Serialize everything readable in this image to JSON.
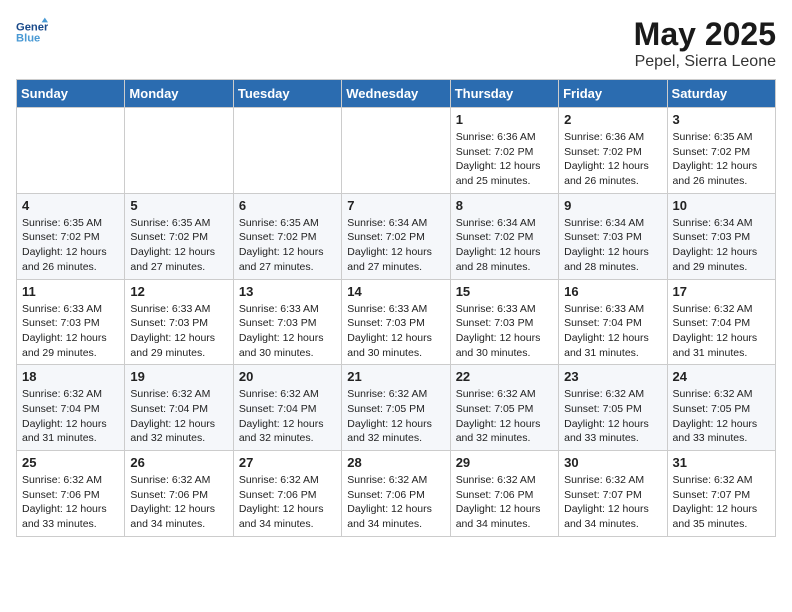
{
  "header": {
    "logo_line1": "General",
    "logo_line2": "Blue",
    "month": "May 2025",
    "location": "Pepel, Sierra Leone"
  },
  "weekdays": [
    "Sunday",
    "Monday",
    "Tuesday",
    "Wednesday",
    "Thursday",
    "Friday",
    "Saturday"
  ],
  "weeks": [
    [
      {
        "day": "",
        "info": ""
      },
      {
        "day": "",
        "info": ""
      },
      {
        "day": "",
        "info": ""
      },
      {
        "day": "",
        "info": ""
      },
      {
        "day": "1",
        "info": "Sunrise: 6:36 AM\nSunset: 7:02 PM\nDaylight: 12 hours\nand 25 minutes."
      },
      {
        "day": "2",
        "info": "Sunrise: 6:36 AM\nSunset: 7:02 PM\nDaylight: 12 hours\nand 26 minutes."
      },
      {
        "day": "3",
        "info": "Sunrise: 6:35 AM\nSunset: 7:02 PM\nDaylight: 12 hours\nand 26 minutes."
      }
    ],
    [
      {
        "day": "4",
        "info": "Sunrise: 6:35 AM\nSunset: 7:02 PM\nDaylight: 12 hours\nand 26 minutes."
      },
      {
        "day": "5",
        "info": "Sunrise: 6:35 AM\nSunset: 7:02 PM\nDaylight: 12 hours\nand 27 minutes."
      },
      {
        "day": "6",
        "info": "Sunrise: 6:35 AM\nSunset: 7:02 PM\nDaylight: 12 hours\nand 27 minutes."
      },
      {
        "day": "7",
        "info": "Sunrise: 6:34 AM\nSunset: 7:02 PM\nDaylight: 12 hours\nand 27 minutes."
      },
      {
        "day": "8",
        "info": "Sunrise: 6:34 AM\nSunset: 7:02 PM\nDaylight: 12 hours\nand 28 minutes."
      },
      {
        "day": "9",
        "info": "Sunrise: 6:34 AM\nSunset: 7:03 PM\nDaylight: 12 hours\nand 28 minutes."
      },
      {
        "day": "10",
        "info": "Sunrise: 6:34 AM\nSunset: 7:03 PM\nDaylight: 12 hours\nand 29 minutes."
      }
    ],
    [
      {
        "day": "11",
        "info": "Sunrise: 6:33 AM\nSunset: 7:03 PM\nDaylight: 12 hours\nand 29 minutes."
      },
      {
        "day": "12",
        "info": "Sunrise: 6:33 AM\nSunset: 7:03 PM\nDaylight: 12 hours\nand 29 minutes."
      },
      {
        "day": "13",
        "info": "Sunrise: 6:33 AM\nSunset: 7:03 PM\nDaylight: 12 hours\nand 30 minutes."
      },
      {
        "day": "14",
        "info": "Sunrise: 6:33 AM\nSunset: 7:03 PM\nDaylight: 12 hours\nand 30 minutes."
      },
      {
        "day": "15",
        "info": "Sunrise: 6:33 AM\nSunset: 7:03 PM\nDaylight: 12 hours\nand 30 minutes."
      },
      {
        "day": "16",
        "info": "Sunrise: 6:33 AM\nSunset: 7:04 PM\nDaylight: 12 hours\nand 31 minutes."
      },
      {
        "day": "17",
        "info": "Sunrise: 6:32 AM\nSunset: 7:04 PM\nDaylight: 12 hours\nand 31 minutes."
      }
    ],
    [
      {
        "day": "18",
        "info": "Sunrise: 6:32 AM\nSunset: 7:04 PM\nDaylight: 12 hours\nand 31 minutes."
      },
      {
        "day": "19",
        "info": "Sunrise: 6:32 AM\nSunset: 7:04 PM\nDaylight: 12 hours\nand 32 minutes."
      },
      {
        "day": "20",
        "info": "Sunrise: 6:32 AM\nSunset: 7:04 PM\nDaylight: 12 hours\nand 32 minutes."
      },
      {
        "day": "21",
        "info": "Sunrise: 6:32 AM\nSunset: 7:05 PM\nDaylight: 12 hours\nand 32 minutes."
      },
      {
        "day": "22",
        "info": "Sunrise: 6:32 AM\nSunset: 7:05 PM\nDaylight: 12 hours\nand 32 minutes."
      },
      {
        "day": "23",
        "info": "Sunrise: 6:32 AM\nSunset: 7:05 PM\nDaylight: 12 hours\nand 33 minutes."
      },
      {
        "day": "24",
        "info": "Sunrise: 6:32 AM\nSunset: 7:05 PM\nDaylight: 12 hours\nand 33 minutes."
      }
    ],
    [
      {
        "day": "25",
        "info": "Sunrise: 6:32 AM\nSunset: 7:06 PM\nDaylight: 12 hours\nand 33 minutes."
      },
      {
        "day": "26",
        "info": "Sunrise: 6:32 AM\nSunset: 7:06 PM\nDaylight: 12 hours\nand 34 minutes."
      },
      {
        "day": "27",
        "info": "Sunrise: 6:32 AM\nSunset: 7:06 PM\nDaylight: 12 hours\nand 34 minutes."
      },
      {
        "day": "28",
        "info": "Sunrise: 6:32 AM\nSunset: 7:06 PM\nDaylight: 12 hours\nand 34 minutes."
      },
      {
        "day": "29",
        "info": "Sunrise: 6:32 AM\nSunset: 7:06 PM\nDaylight: 12 hours\nand 34 minutes."
      },
      {
        "day": "30",
        "info": "Sunrise: 6:32 AM\nSunset: 7:07 PM\nDaylight: 12 hours\nand 34 minutes."
      },
      {
        "day": "31",
        "info": "Sunrise: 6:32 AM\nSunset: 7:07 PM\nDaylight: 12 hours\nand 35 minutes."
      }
    ]
  ]
}
